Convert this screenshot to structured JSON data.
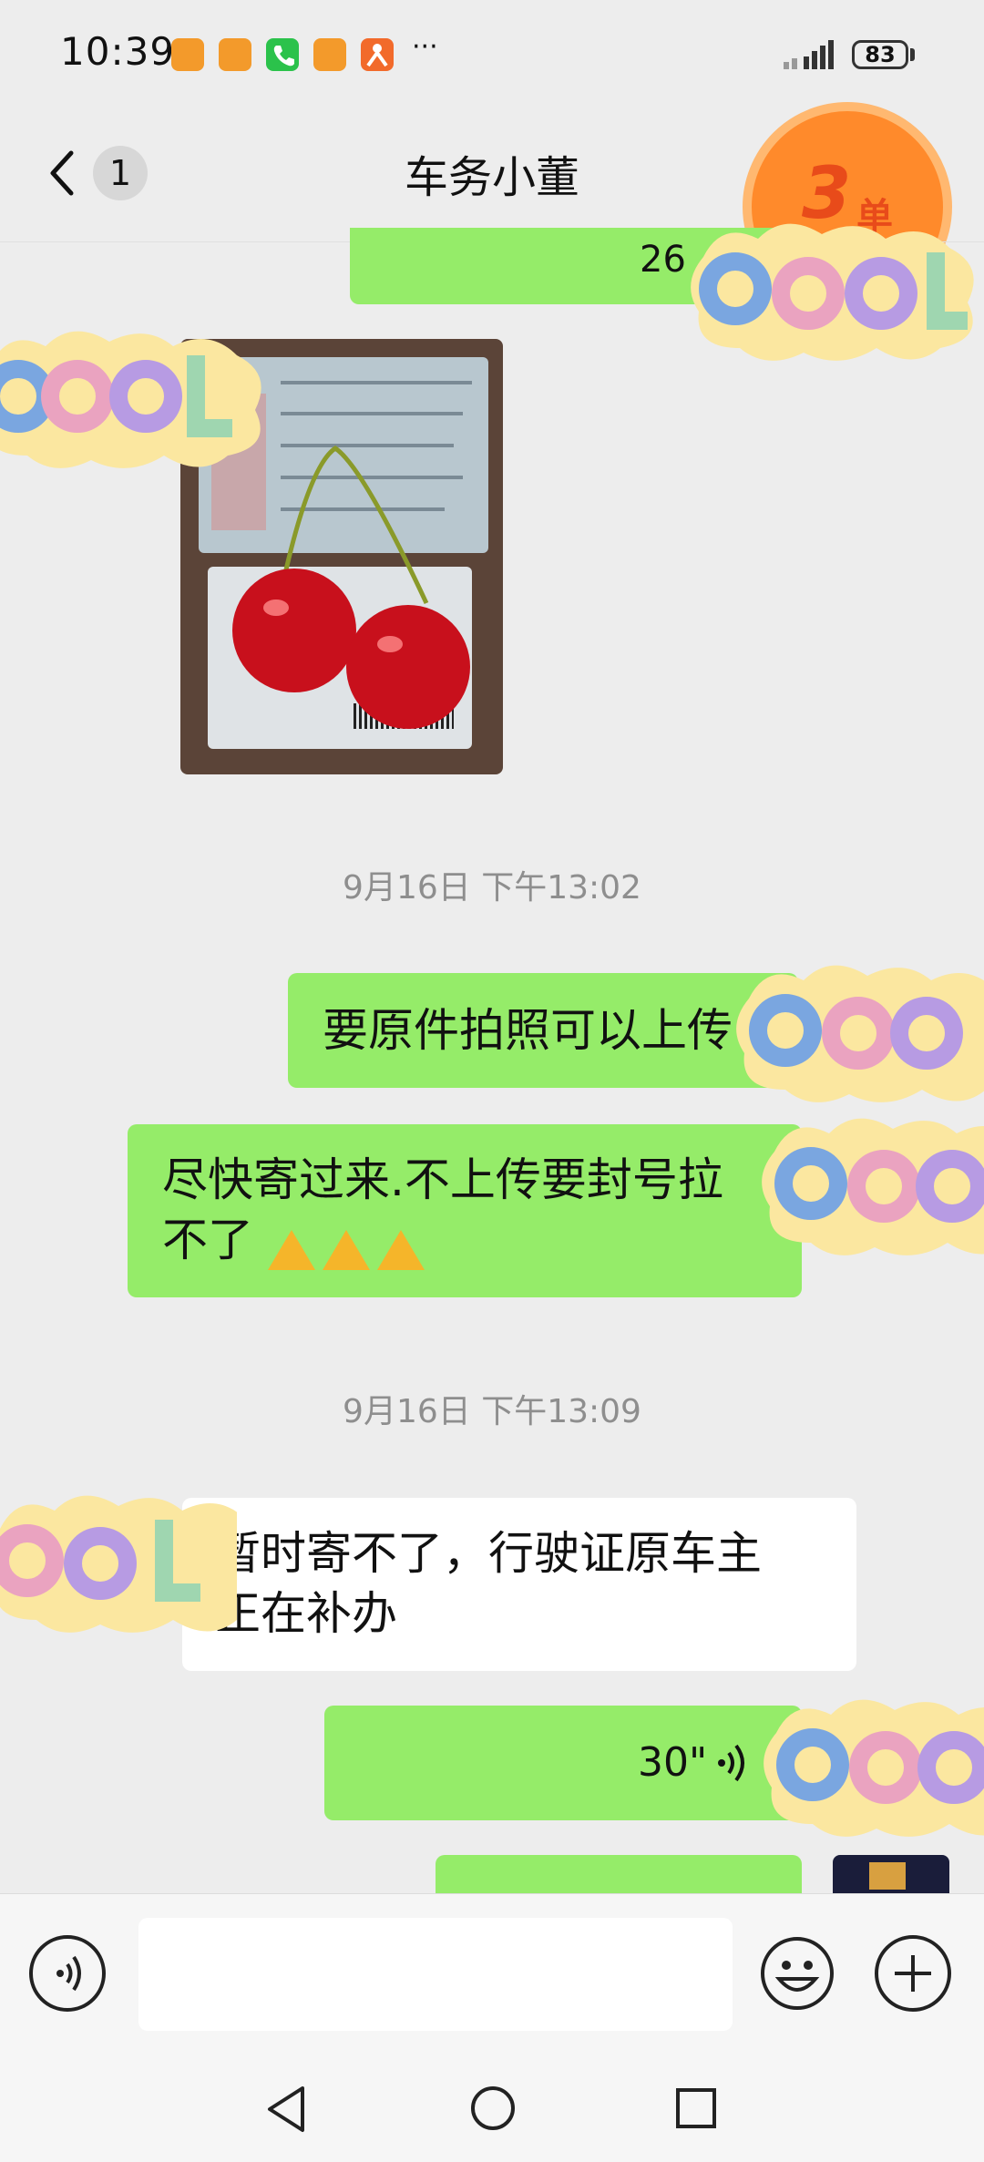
{
  "status_bar": {
    "time": "10:39",
    "more_indicator": "···",
    "battery": "83"
  },
  "header": {
    "unread_count": "1",
    "title": "车务小董",
    "order_badge_number": "3",
    "order_badge_unit": "单"
  },
  "messages": {
    "voice_top_duration": "26",
    "timestamp_1": "9月16日 下午13:02",
    "msg_1": "要原件拍照可以上传",
    "msg_2_line1": "尽快寄过来.不上传要封号拉",
    "msg_2_line2": "不了",
    "timestamp_2": "9月16日 下午13:09",
    "msg_3_line1": "暂时寄不了，行驶证原车主",
    "msg_3_line2": "正在补办",
    "voice_duration": "30\""
  },
  "stickers": {
    "text": "COOL"
  },
  "colors": {
    "bubble_green": "#95ec69",
    "background": "#ededed",
    "badge_orange": "#ff8a2b"
  },
  "icons": [
    "back-icon",
    "voice-icon",
    "emoji-icon",
    "add-icon",
    "nav-back-icon",
    "nav-home-icon",
    "nav-recents-icon",
    "signal-icon",
    "battery-icon"
  ]
}
